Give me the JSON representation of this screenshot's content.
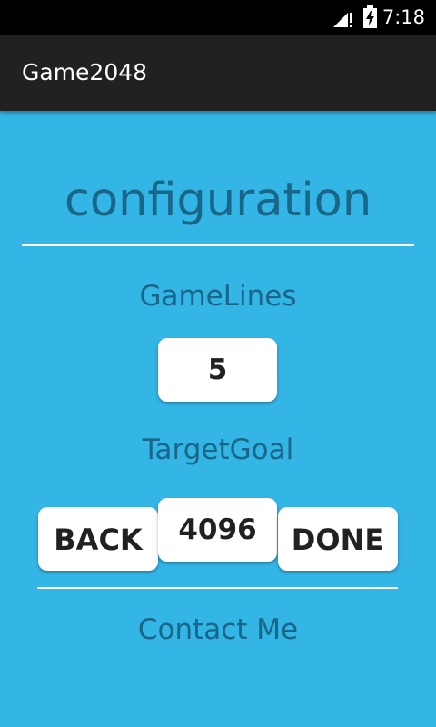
{
  "status_bar": {
    "time": "7:18",
    "icons": [
      "signal-icon",
      "battery-icon"
    ]
  },
  "action_bar": {
    "title": "Game2048"
  },
  "screen": {
    "title": "configuration",
    "game_lines_label": "GameLines",
    "game_lines_value": "5",
    "target_goal_label": "TargetGoal",
    "target_goal_value": "4096",
    "back_label": "BACK",
    "done_label": "DONE",
    "contact_label": "Contact Me"
  },
  "colors": {
    "background": "#33b5e5",
    "action_bar": "#212121",
    "status_bar": "#000000",
    "label_text": "#1a6688",
    "button_bg": "#ffffff",
    "button_text": "#212121",
    "divider": "#ffffff"
  }
}
